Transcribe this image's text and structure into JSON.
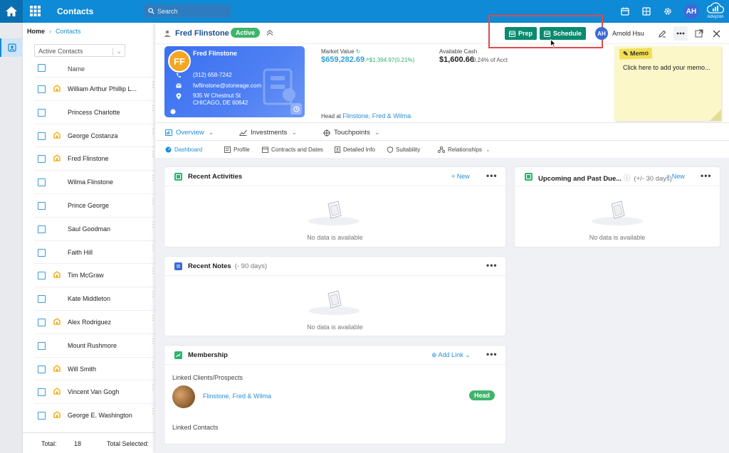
{
  "app": {
    "title": "Contacts",
    "brand": "Advyzon",
    "user_initials": "AH"
  },
  "search": {
    "placeholder": "Search"
  },
  "breadcrumb": {
    "home": "Home",
    "current": "Contacts"
  },
  "list": {
    "filter_label": "Active Contacts",
    "column_name": "Name",
    "rows": [
      {
        "name": "William Arthur Phillip L...",
        "star": true
      },
      {
        "name": "Princess Charlotte",
        "star": false
      },
      {
        "name": "George Costanza",
        "star": true
      },
      {
        "name": "Fred Flinstone",
        "star": true
      },
      {
        "name": "Wilma Flinstone",
        "star": false
      },
      {
        "name": "Prince George",
        "star": false
      },
      {
        "name": "Saul Goodman",
        "star": false
      },
      {
        "name": "Faith Hill",
        "star": false
      },
      {
        "name": "Tim McGraw",
        "star": true
      },
      {
        "name": "Kate Middleton",
        "star": false
      },
      {
        "name": "Alex Rodriguez",
        "star": true
      },
      {
        "name": "Mount Rushmore",
        "star": false
      },
      {
        "name": "Will Smith",
        "star": true
      },
      {
        "name": "Vincent Van Gogh",
        "star": true
      },
      {
        "name": "George E. Washington",
        "star": true
      }
    ],
    "total_label": "Total:",
    "total_value": "18",
    "selected_label": "Total Selected:"
  },
  "contact": {
    "name": "Fred Flinstone",
    "status": "Active",
    "prep_label": "Prep",
    "schedule_label": "Schedule",
    "advisor_initials": "AH",
    "advisor_name": "Arnold Hsu",
    "card": {
      "initials": "FF",
      "name": "Fred Flinstone",
      "phone": "(312) 658-7242",
      "email": "fwflinstone@stoneage.com",
      "address1": "935 W Chestnut St",
      "address2": "CHICAGO, DE 60642"
    },
    "market_value_label": "Market Value",
    "market_value": "$659,282.69",
    "market_change": "$1,394.97(0.21%)",
    "available_cash_label": "Available Cash",
    "available_cash": "$1,600.66",
    "available_cash_sub": "0.24% of Acct",
    "head_at_label": "Head at",
    "head_at_link": "Flinstone, Fred & Wilma",
    "memo_tag": "Memo",
    "memo_text": "Click here to add your memo..."
  },
  "tabs_primary": [
    {
      "label": "Overview",
      "selected": true
    },
    {
      "label": "Investments",
      "selected": false
    },
    {
      "label": "Touchpoints",
      "selected": false
    }
  ],
  "tabs_secondary": [
    {
      "label": "Dashboard",
      "selected": true
    },
    {
      "label": "Profile",
      "selected": false
    },
    {
      "label": "Contracts and Dates",
      "selected": false
    },
    {
      "label": "Detailed Info",
      "selected": false
    },
    {
      "label": "Suitability",
      "selected": false
    },
    {
      "label": "Relationships",
      "selected": false
    }
  ],
  "panels": {
    "recent_activities": {
      "title": "Recent Activities",
      "new_label": "New",
      "empty": "No data is available"
    },
    "upcoming": {
      "title": "Upcoming and Past Due...",
      "sub": "(+/- 30 days)",
      "new_label": "New",
      "empty": "No data is available"
    },
    "recent_notes": {
      "title": "Recent Notes",
      "sub": "(- 90 days)",
      "empty": "No data is available"
    },
    "membership": {
      "title": "Membership",
      "add_link_label": "Add Link",
      "linked_clients_label": "Linked Clients/Prospects",
      "household": "Flinstone, Fred & Wilma",
      "household_role": "Head",
      "linked_contacts_label": "Linked Contacts"
    }
  },
  "colors": {
    "accent": "#0f8ad6",
    "action_green": "#0a8a6e",
    "status_green": "#3fb56a",
    "highlight_red": "#e24848"
  }
}
